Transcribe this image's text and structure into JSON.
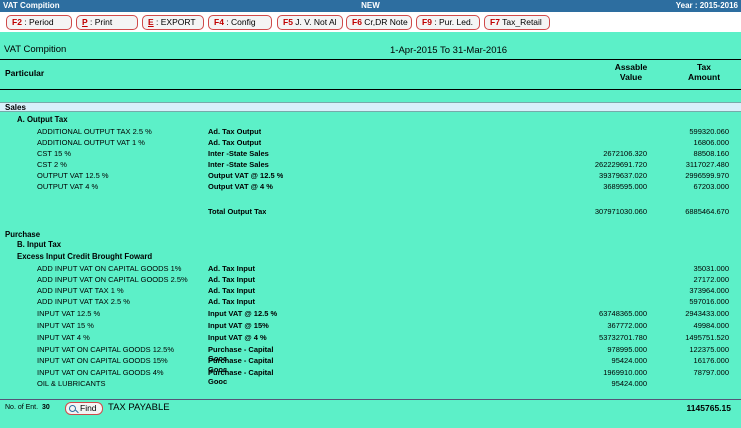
{
  "window": {
    "title": "VAT Compition",
    "center": "NEW",
    "year": "Year : 2015-2016"
  },
  "toolbar": [
    {
      "key": "F2",
      "label": " : Period",
      "underline": false
    },
    {
      "key": "P",
      "label": " : Print",
      "underline": true
    },
    {
      "key": "E",
      "label": " : EXPORT",
      "underline": true
    },
    {
      "key": "F4",
      "label": " : Config",
      "underline": false
    },
    {
      "key": "F5",
      "label": " J. V. Not Al",
      "underline": false
    },
    {
      "key": "F6",
      "label": " Cr,DR Note",
      "underline": false
    },
    {
      "key": "F9",
      "label": " : Pur. Led.",
      "underline": false
    },
    {
      "key": "F7",
      "label": " Tax_Retail",
      "underline": false
    }
  ],
  "report": {
    "title": "VAT Compition",
    "period": "1-Apr-2015 To 31-Mar-2016",
    "columns": {
      "particular": "Particular",
      "assable": "Assable Value",
      "tax": "Tax Amount"
    },
    "sales": {
      "label": "Sales",
      "output_tax": "A. Output Tax",
      "rows": [
        {
          "particular": "ADDITIONAL OUTPUT TAX 2.5 %",
          "account": "Ad. Tax Output",
          "assable": "",
          "tax": "599320.060"
        },
        {
          "particular": "ADDITIONAL OUTPUT VAT 1 %",
          "account": "Ad. Tax Output",
          "assable": "",
          "tax": "16806.000"
        },
        {
          "particular": "CST 15 %",
          "account": "Inter -State Sales",
          "assable": "2672106.320",
          "tax": "88508.160"
        },
        {
          "particular": "CST 2 %",
          "account": "Inter -State Sales",
          "assable": "262229691.720",
          "tax": "3117027.480"
        },
        {
          "particular": "OUTPUT VAT 12.5 %",
          "account": "Output VAT @ 12.5 %",
          "assable": "39379637.020",
          "tax": "2996599.970"
        },
        {
          "particular": "OUTPUT VAT 4 %",
          "account": "Output VAT @ 4 %",
          "assable": "3689595.000",
          "tax": "67203.000"
        }
      ],
      "total": {
        "label": "Total Output Tax",
        "assable": "307971030.060",
        "tax": "6885464.670"
      }
    },
    "purchase": {
      "label": "Purchase",
      "input_tax": "B. Input Tax",
      "excess": "Excess Input Credit Brought Foward",
      "rows": [
        {
          "particular": "ADD INPUT VAT ON CAPITAL GOODS 1%",
          "account": "Ad. Tax Input",
          "assable": "",
          "tax": "35031.000"
        },
        {
          "particular": "ADD INPUT VAT ON CAPITAL GOODS 2.5%",
          "account": "Ad. Tax Input",
          "assable": "",
          "tax": "27172.000"
        },
        {
          "particular": "ADD INPUT VAT TAX 1 %",
          "account": "Ad. Tax Input",
          "assable": "",
          "tax": "373964.000"
        },
        {
          "particular": "ADD INPUT VAT TAX 2.5 %",
          "account": "Ad. Tax Input",
          "assable": "",
          "tax": "597016.000"
        },
        {
          "particular": "INPUT VAT 12.5 %",
          "account": "Input VAT @ 12.5 %",
          "assable": "63748365.000",
          "tax": "2943433.000"
        },
        {
          "particular": "INPUT VAT 15 %",
          "account": "Input VAT @ 15%",
          "assable": "367772.000",
          "tax": "49984.000"
        },
        {
          "particular": "INPUT VAT 4 %",
          "account": "Input VAT @ 4 %",
          "assable": "53732701.780",
          "tax": "1495751.520"
        },
        {
          "particular": "INPUT VAT ON CAPITAL GOODS 12.5%",
          "account": "Purchase - Capital Gooc",
          "assable": "978995.000",
          "tax": "122375.000"
        },
        {
          "particular": "INPUT VAT ON CAPITAL GOODS 15%",
          "account": "Purchase - Capital Gooc",
          "assable": "95424.000",
          "tax": "16176.000"
        },
        {
          "particular": "INPUT VAT ON CAPITAL GOODS 4%",
          "account": "Purchase - Capital Gooc",
          "assable": "1969910.000",
          "tax": "78797.000"
        },
        {
          "particular": "OIL & LUBRICANTS",
          "account": "",
          "assable": "95424.000",
          "tax": ""
        }
      ]
    }
  },
  "footer": {
    "entries_label": "No. of Ent.",
    "entries_count": "30",
    "find_label": "Find",
    "tax_payable_label": "TAX PAYABLE",
    "tax_payable_value": "1145765.15"
  },
  "colors": {
    "background": "#5cf0c8",
    "titlebar": "#2d6ea0",
    "section_band": "#d8f0fa",
    "button_border": "#d04a4a"
  }
}
